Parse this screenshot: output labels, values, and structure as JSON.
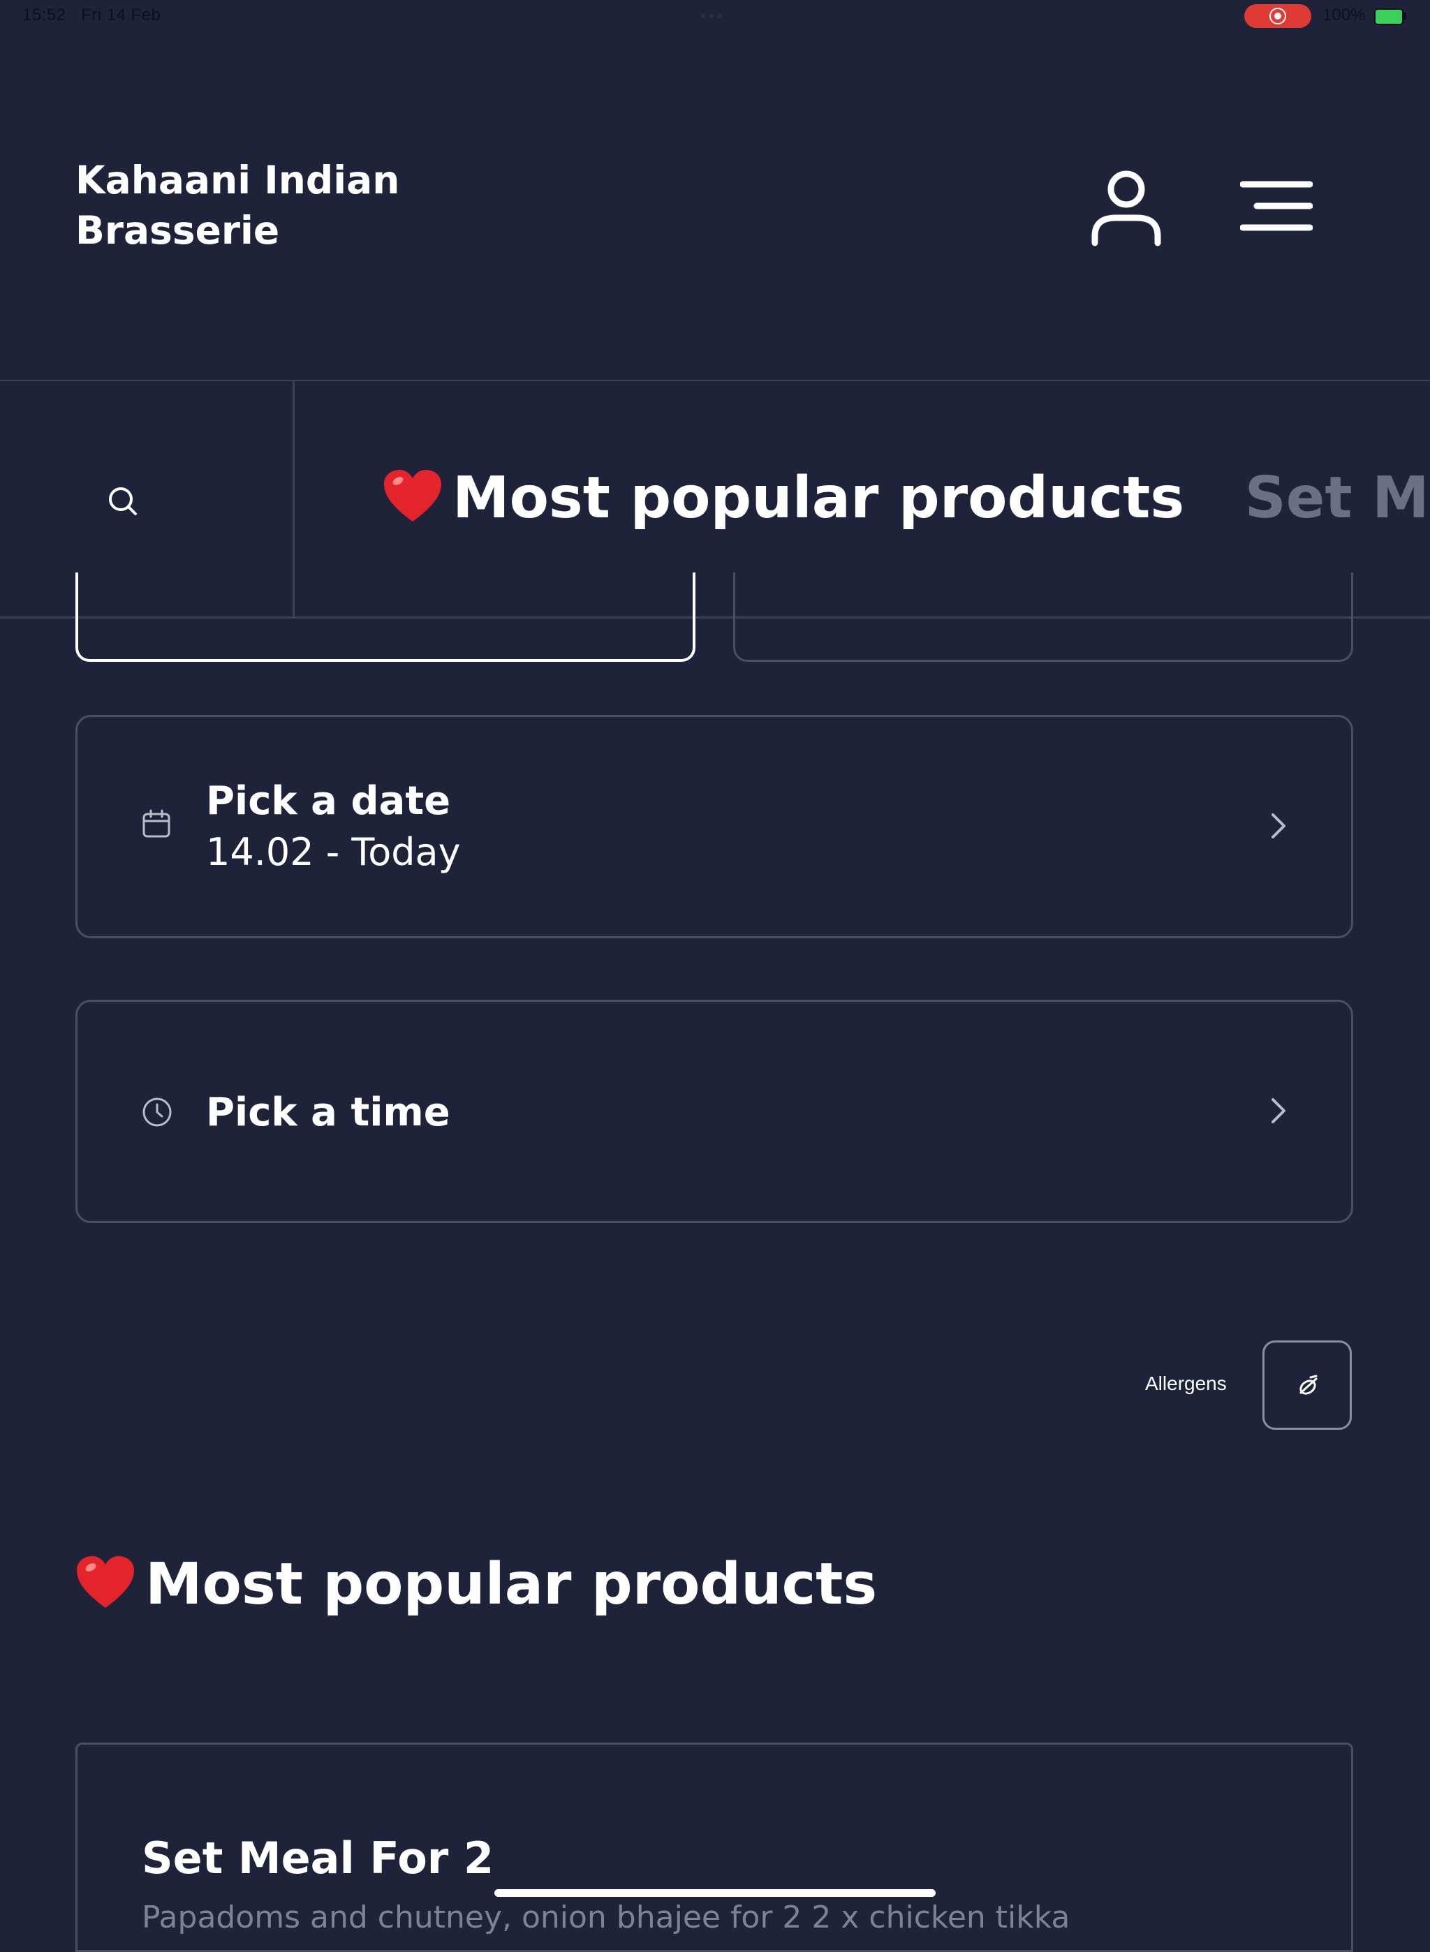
{
  "status_bar": {
    "time": "15:52",
    "date": "Fri 14 Feb",
    "battery": "100%",
    "record_color": "#e03a34",
    "battery_color": "#3dcf5a"
  },
  "header": {
    "brand_line1": "Kahaani Indian",
    "brand_line2": "Brasserie",
    "user_icon": "user-icon",
    "menu_icon": "menu-icon"
  },
  "category_nav": {
    "search_icon": "search-icon",
    "tabs": [
      {
        "emoji": "❤️",
        "label": "Most popular products",
        "active": true
      },
      {
        "label": "Set Meals",
        "active": false
      }
    ]
  },
  "order_options": {
    "date": {
      "title": "Pick a date",
      "value": "14.02 - Today",
      "icon": "calendar-icon"
    },
    "time": {
      "title": "Pick a time",
      "icon": "clock-icon"
    }
  },
  "allergens": {
    "label": "Allergens",
    "icon": "allergen-icon"
  },
  "section": {
    "emoji": "❤️",
    "title": "Most popular products"
  },
  "products": [
    {
      "name": "Set Meal For 2",
      "description": "Papadoms and chutney, onion bhajee for 2 2 x chicken tikka"
    }
  ],
  "colors": {
    "background": "#1f2339",
    "border": "#4a4f66",
    "text": "#ffffff",
    "muted": "#6c7085"
  }
}
